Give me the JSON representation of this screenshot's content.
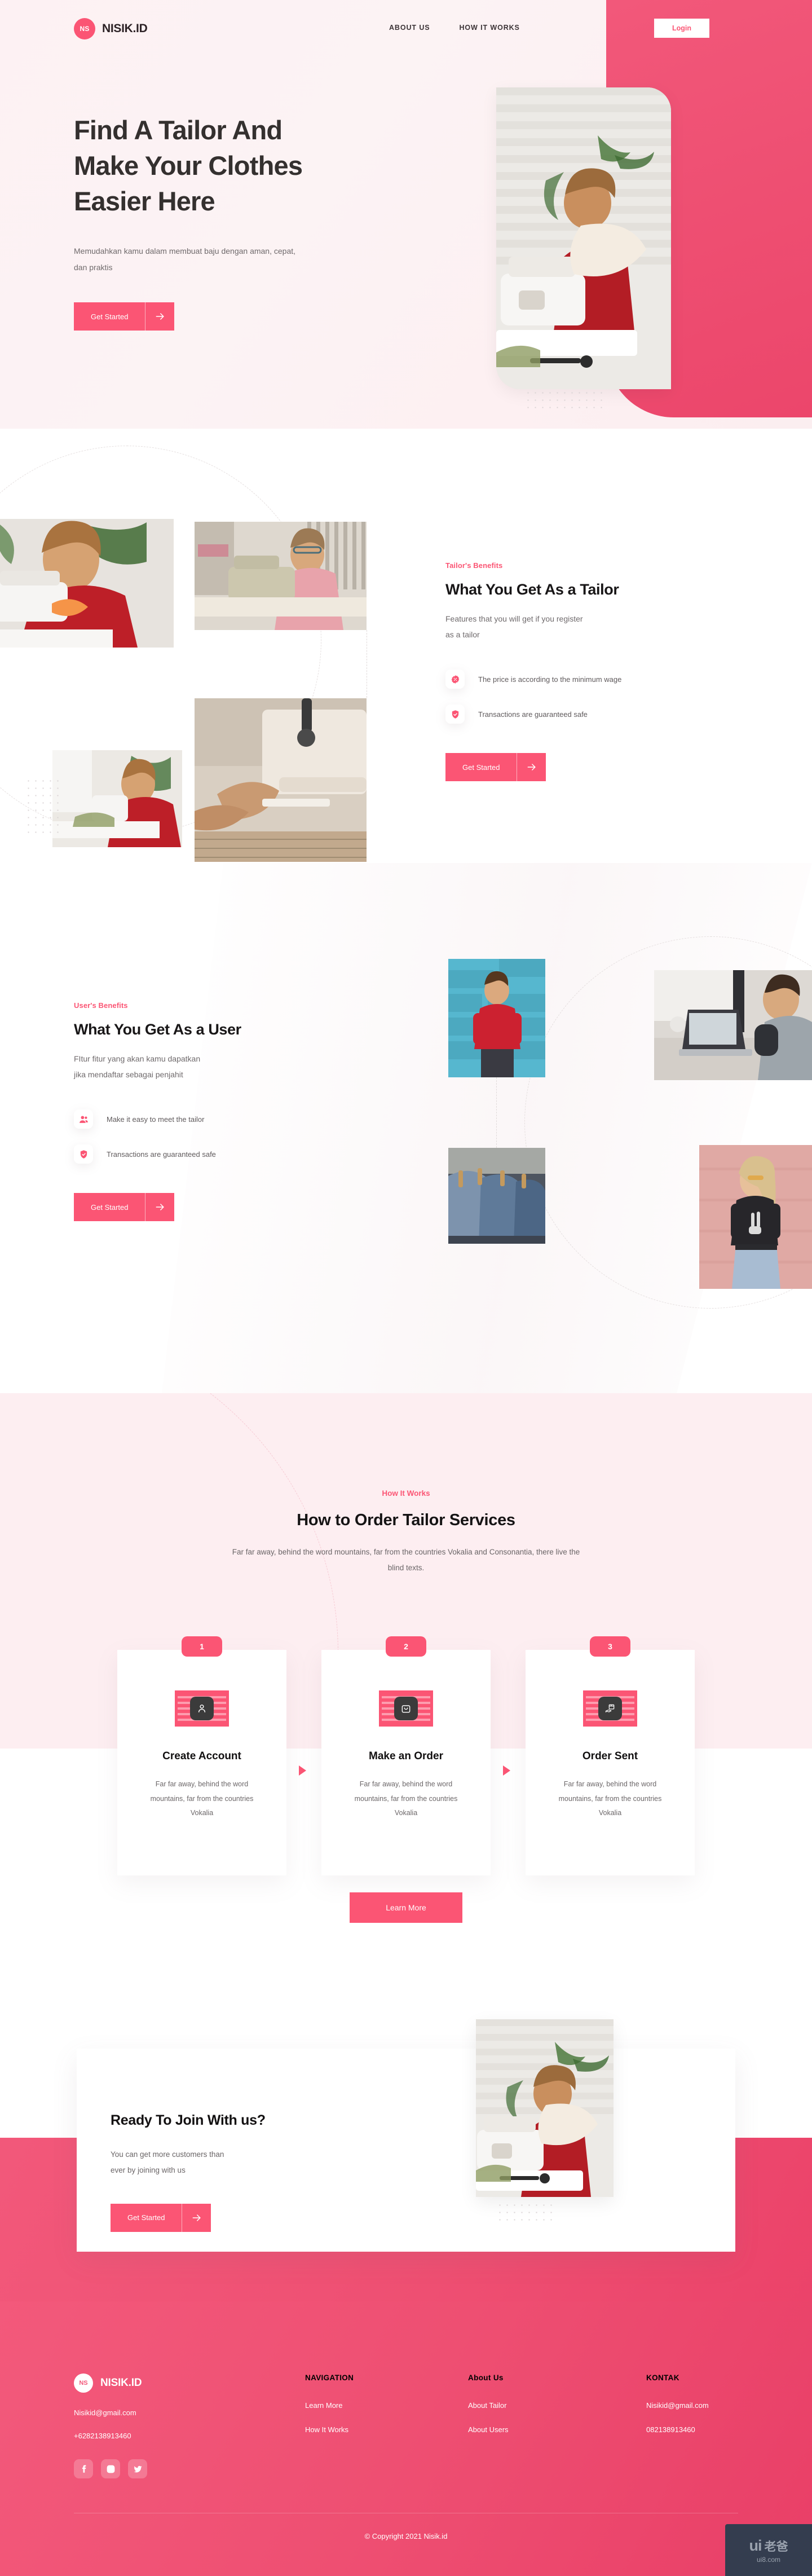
{
  "brand": {
    "badge": "NS",
    "name": "NISIK.ID"
  },
  "header": {
    "nav": [
      {
        "label": "ABOUT US"
      },
      {
        "label": "HOW IT WORKS"
      }
    ],
    "login_label": "Login"
  },
  "hero": {
    "title_line1": "Find A Tailor And",
    "title_line2": "Make Your Clothes",
    "title_line3": "Easier Here",
    "subtitle": "Memudahkan kamu dalam membuat baju dengan aman, cepat, dan praktis",
    "cta_label": "Get Started"
  },
  "tailor": {
    "eyebrow": "Tailor's Benefits",
    "title": "What You Get As a Tailor",
    "desc_line1": "Features that you will get if you register",
    "desc_line2": "as a tailor",
    "features": [
      {
        "icon": "discount-badge-icon",
        "label": "The price is according to the minimum wage"
      },
      {
        "icon": "shield-check-icon",
        "label": "Transactions are guaranteed safe"
      }
    ],
    "cta_label": "Get Started"
  },
  "user": {
    "eyebrow": "User's Benefits",
    "title": "What You Get As a User",
    "desc_line1": "FItur fitur yang akan kamu dapatkan",
    "desc_line2": "jika mendaftar sebagai penjahit",
    "features": [
      {
        "icon": "users-icon",
        "label": "Make it easy to meet the tailor"
      },
      {
        "icon": "shield-check-icon",
        "label": "Transactions are guaranteed safe"
      }
    ],
    "cta_label": "Get Started"
  },
  "how": {
    "eyebrow": "How It Works",
    "title": "How to Order Tailor Services",
    "desc": "Far far away, behind the word mountains, far from the countries Vokalia and Consonantia, there live the blind texts.",
    "steps": [
      {
        "number": "1",
        "icon": "person-card-icon",
        "title": "Create Account",
        "desc": "Far far away, behind the word mountains, far from the countries Vokalia"
      },
      {
        "number": "2",
        "icon": "shopping-bag-icon",
        "title": "Make an Order",
        "desc": "Far far away, behind the word mountains, far from the countries Vokalia"
      },
      {
        "number": "3",
        "icon": "package-delivery-icon",
        "title": "Order Sent",
        "desc": "Far far away, behind the word mountains, far from the countries Vokalia"
      }
    ],
    "learn_more_label": "Learn More"
  },
  "cta": {
    "title": "Ready To Join With us?",
    "desc_line1": "You can get more customers than",
    "desc_line2": "ever by joining with us",
    "button_label": "Get Started"
  },
  "footer": {
    "email": "Nisikid@gmail.com",
    "phone": "+6282138913460",
    "socials": [
      {
        "name": "facebook-icon"
      },
      {
        "name": "instagram-icon"
      },
      {
        "name": "twitter-icon"
      }
    ],
    "columns": [
      {
        "heading": "NAVIGATION",
        "links": [
          {
            "label": "Learn More"
          },
          {
            "label": "How It Works"
          }
        ]
      },
      {
        "heading": "About Us",
        "links": [
          {
            "label": "About Tailor"
          },
          {
            "label": "About Users"
          }
        ]
      },
      {
        "heading": "KONTAK",
        "links": [
          {
            "label": "Nisikid@gmail.com"
          },
          {
            "label": "082138913460"
          }
        ]
      }
    ],
    "copyright": "© Copyright 2021 Nisik.id"
  },
  "watermark": {
    "text_left": "ui",
    "text_right": "老爸",
    "url": "ui8.com"
  },
  "colors": {
    "accent": "#fb5574",
    "accent_deep": "#ee4f72",
    "hero_bg": "#fdf1f3",
    "section_soft": "#fdeef1",
    "text_dark": "#191718",
    "text_muted": "#6f6a6c"
  }
}
